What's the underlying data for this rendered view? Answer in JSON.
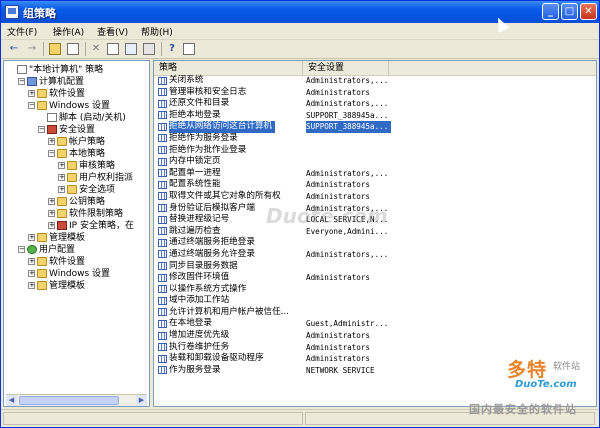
{
  "window": {
    "title": "组策略"
  },
  "menu": [
    "文件(F)",
    "操作(A)",
    "查看(V)",
    "帮助(H)"
  ],
  "tree": [
    {
      "label": "\"本地计算机\" 策略",
      "icon": "doc-icon",
      "exp": "",
      "indent": 0
    },
    {
      "label": "计算机配置",
      "icon": "computer-icon",
      "exp": "−",
      "indent": 1
    },
    {
      "label": "软件设置",
      "icon": "folder-icon",
      "exp": "+",
      "indent": 2
    },
    {
      "label": "Windows 设置",
      "icon": "folder-icon",
      "exp": "−",
      "indent": 2
    },
    {
      "label": "脚本 (启动/关机)",
      "icon": "doc-icon",
      "exp": "",
      "indent": 3
    },
    {
      "label": "安全设置",
      "icon": "shield-icon",
      "exp": "−",
      "indent": 3
    },
    {
      "label": "帐户策略",
      "icon": "folder-icon",
      "exp": "+",
      "indent": 4
    },
    {
      "label": "本地策略",
      "icon": "folder-icon",
      "exp": "−",
      "indent": 4
    },
    {
      "label": "审核策略",
      "icon": "folder-icon",
      "exp": "+",
      "indent": 5
    },
    {
      "label": "用户权利指派",
      "icon": "folder-icon",
      "exp": "+",
      "indent": 5
    },
    {
      "label": "安全选项",
      "icon": "folder-icon",
      "exp": "+",
      "indent": 5
    },
    {
      "label": "公钥策略",
      "icon": "folder-icon",
      "exp": "+",
      "indent": 4
    },
    {
      "label": "软件限制策略",
      "icon": "folder-icon",
      "exp": "+",
      "indent": 4
    },
    {
      "label": "IP 安全策略，在",
      "icon": "shield-icon",
      "exp": "+",
      "indent": 4
    },
    {
      "label": "管理模板",
      "icon": "folder-icon",
      "exp": "+",
      "indent": 2
    },
    {
      "label": "用户配置",
      "icon": "user-icon",
      "exp": "−",
      "indent": 1
    },
    {
      "label": "软件设置",
      "icon": "folder-icon",
      "exp": "+",
      "indent": 2
    },
    {
      "label": "Windows 设置",
      "icon": "folder-icon",
      "exp": "+",
      "indent": 2
    },
    {
      "label": "管理模板",
      "icon": "folder-icon",
      "exp": "+",
      "indent": 2
    }
  ],
  "list": {
    "col_policy": "策略",
    "col_setting": "安全设置",
    "rows": [
      {
        "name": "关闭系统",
        "setting": "Administrators,..."
      },
      {
        "name": "管理审核和安全日志",
        "setting": "Administrators"
      },
      {
        "name": "还原文件和目录",
        "setting": "Administrators,..."
      },
      {
        "name": "拒绝本地登录",
        "setting": "SUPPORT_388945a..."
      },
      {
        "name": "拒绝从网络访问这台计算机",
        "setting": "SUPPORT_388945a...",
        "selected": true
      },
      {
        "name": "拒绝作为服务登录",
        "setting": ""
      },
      {
        "name": "拒绝作为批作业登录",
        "setting": ""
      },
      {
        "name": "内存中锁定页",
        "setting": ""
      },
      {
        "name": "配置单一进程",
        "setting": "Administrators,..."
      },
      {
        "name": "配置系统性能",
        "setting": "Administrators"
      },
      {
        "name": "取得文件或其它对象的所有权",
        "setting": "Administrators"
      },
      {
        "name": "身份验证后模拟客户端",
        "setting": "Administrators,..."
      },
      {
        "name": "替换进程级记号",
        "setting": "LOCAL SERVICE,N..."
      },
      {
        "name": "跳过遍历检查",
        "setting": "Everyone,Admini..."
      },
      {
        "name": "通过终端服务拒绝登录",
        "setting": ""
      },
      {
        "name": "通过终端服务允许登录",
        "setting": "Administrators,..."
      },
      {
        "name": "同步目录服务数据",
        "setting": ""
      },
      {
        "name": "修改固件环境值",
        "setting": "Administrators"
      },
      {
        "name": "以操作系统方式操作",
        "setting": ""
      },
      {
        "name": "域中添加工作站",
        "setting": ""
      },
      {
        "name": "允许计算机和用户帐户被信任...",
        "setting": ""
      },
      {
        "name": "在本地登录",
        "setting": "Guest,Administr..."
      },
      {
        "name": "增加进度优先级",
        "setting": "Administrators"
      },
      {
        "name": "执行卷维护任务",
        "setting": "Administrators"
      },
      {
        "name": "装载和卸载设备驱动程序",
        "setting": "Administrators"
      },
      {
        "name": "作为服务登录",
        "setting": "NETWORK SERVICE"
      }
    ]
  },
  "watermark": {
    "brand": "多特",
    "brand_small": "软件站",
    "site": "DuoTe.com",
    "tagline": "国内最安全的软件站",
    "center": "Duote.com"
  }
}
